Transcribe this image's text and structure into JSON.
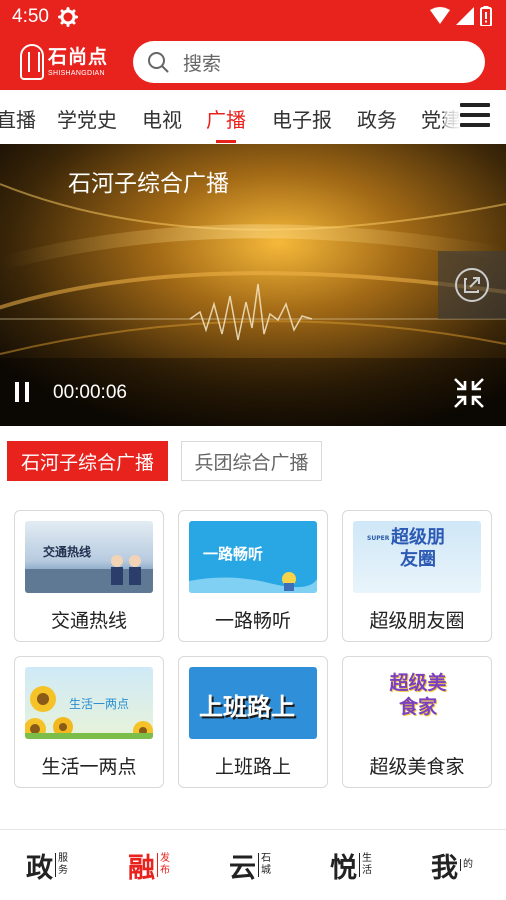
{
  "status_bar": {
    "time": "4:50",
    "icons": [
      "settings-gear-icon",
      "wifi-icon",
      "cell-signal-icon",
      "battery-icon"
    ]
  },
  "app": {
    "logo_cn": "石尚点",
    "logo_en": "SHISHANGDIAN",
    "brand_color": "#e8231e"
  },
  "search": {
    "placeholder": "搜索"
  },
  "tabs": [
    {
      "label": "直播"
    },
    {
      "label": "学党史"
    },
    {
      "label": "电视"
    },
    {
      "label": "广播",
      "active": true
    },
    {
      "label": "电子报"
    },
    {
      "label": "政务"
    },
    {
      "label": "党建"
    }
  ],
  "player": {
    "title": "石河子综合广播",
    "time": "00:00:06",
    "state": "playing"
  },
  "channels": [
    {
      "label": "石河子综合广播",
      "active": true
    },
    {
      "label": "兵团综合广播",
      "active": false
    }
  ],
  "programs": [
    {
      "label": "交通热线",
      "thumb_text": "交通热线"
    },
    {
      "label": "一路畅听",
      "thumb_text": "一路畅听"
    },
    {
      "label": "超级朋友圈",
      "thumb_text": "超级朋友圈",
      "thumb_small": "SUPER"
    },
    {
      "label": "生活一两点",
      "thumb_text": "生活一两点"
    },
    {
      "label": "上班路上",
      "thumb_text": "上班路上"
    },
    {
      "label": "超级美食家",
      "thumb_text": "超级美食家"
    }
  ],
  "bottom_nav": [
    {
      "big": "政",
      "small": "服务",
      "active": false
    },
    {
      "big": "融",
      "small": "发布",
      "active": true
    },
    {
      "big": "云",
      "small": "石城",
      "active": false
    },
    {
      "big": "悦",
      "small": "生活",
      "active": false
    },
    {
      "big": "我",
      "small": "的",
      "active": false
    }
  ]
}
